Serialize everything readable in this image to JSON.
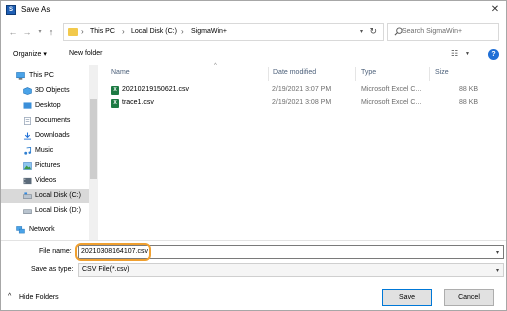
{
  "window": {
    "title": "Save As",
    "app_icon": "S"
  },
  "address": {
    "crumbs": [
      "This PC",
      "Local Disk (C:)",
      "SigmaWin+"
    ]
  },
  "search": {
    "placeholder": "Search SigmaWin+"
  },
  "toolbar": {
    "organize_label": "Organize ▾",
    "new_folder_label": "New folder",
    "help_label": "?"
  },
  "nav": {
    "items": [
      {
        "label": "This PC",
        "icon": "computer-icon"
      },
      {
        "label": "3D Objects",
        "icon": "3d-objects-icon"
      },
      {
        "label": "Desktop",
        "icon": "desktop-icon"
      },
      {
        "label": "Documents",
        "icon": "documents-icon"
      },
      {
        "label": "Downloads",
        "icon": "downloads-icon"
      },
      {
        "label": "Music",
        "icon": "music-icon"
      },
      {
        "label": "Pictures",
        "icon": "pictures-icon"
      },
      {
        "label": "Videos",
        "icon": "videos-icon"
      },
      {
        "label": "Local Disk (C:)",
        "icon": "drive-icon",
        "selected": true
      },
      {
        "label": "Local Disk (D:)",
        "icon": "drive-icon"
      },
      {
        "label": "Network",
        "icon": "network-icon"
      }
    ]
  },
  "columns": {
    "name": "Name",
    "date": "Date modified",
    "type": "Type",
    "size": "Size"
  },
  "files": [
    {
      "name": "20210219150621.csv",
      "date": "2/19/2021 3:07 PM",
      "type": "Microsoft Excel C...",
      "size": "88 KB"
    },
    {
      "name": "trace1.csv",
      "date": "2/19/2021 3:08 PM",
      "type": "Microsoft Excel C...",
      "size": "88 KB"
    }
  ],
  "form": {
    "file_name_label": "File name:",
    "file_name_value": "20210308164107.csv",
    "save_as_type_label": "Save as type:",
    "save_as_type_value": "CSV File(*.csv)"
  },
  "footer": {
    "hide_folders_label": "Hide Folders",
    "save_label": "Save",
    "cancel_label": "Cancel"
  },
  "colors": {
    "accent": "#0078d7",
    "highlight_ring": "#f0a030",
    "excel_green": "#1d7a43"
  }
}
